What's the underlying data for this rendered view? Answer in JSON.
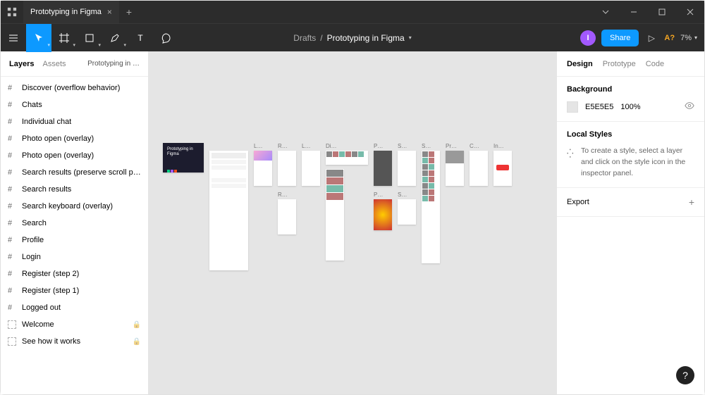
{
  "titlebar": {
    "tab_title": "Prototyping in Figma"
  },
  "toolbar": {
    "breadcrumb_folder": "Drafts",
    "breadcrumb_file": "Prototyping in Figma",
    "avatar_initial": "I",
    "share_label": "Share",
    "missing_fonts": "A?",
    "zoom": "7%"
  },
  "left_panel": {
    "tabs": {
      "layers": "Layers",
      "assets": "Assets"
    },
    "page_selector": "Prototyping in …",
    "items": [
      {
        "type": "frame",
        "label": "Discover (overflow behavior)"
      },
      {
        "type": "frame",
        "label": "Chats"
      },
      {
        "type": "frame",
        "label": "Individual chat"
      },
      {
        "type": "frame",
        "label": "Photo open (overlay)"
      },
      {
        "type": "frame",
        "label": "Photo open (overlay)"
      },
      {
        "type": "frame",
        "label": "Search results (preserve scroll po…"
      },
      {
        "type": "frame",
        "label": "Search results"
      },
      {
        "type": "frame",
        "label": "Search keyboard (overlay)"
      },
      {
        "type": "frame",
        "label": "Search"
      },
      {
        "type": "frame",
        "label": "Profile"
      },
      {
        "type": "frame",
        "label": "Login"
      },
      {
        "type": "frame",
        "label": "Register (step 2)"
      },
      {
        "type": "frame",
        "label": "Register (step 1)"
      },
      {
        "type": "frame",
        "label": "Logged out"
      },
      {
        "type": "component",
        "label": "Welcome",
        "locked": true
      },
      {
        "type": "component",
        "label": "See how it works",
        "locked": true
      }
    ]
  },
  "canvas": {
    "cover_text": "Prototyping in Figma",
    "frame_labels": [
      "L…",
      "R…",
      "L…",
      "Di…",
      "P…",
      "S…",
      "S…",
      "Pr…",
      "C…",
      "In…",
      "R…",
      "P…",
      "S…"
    ]
  },
  "right_panel": {
    "tabs": {
      "design": "Design",
      "prototype": "Prototype",
      "code": "Code"
    },
    "background": {
      "title": "Background",
      "hex": "E5E5E5",
      "opacity": "100%"
    },
    "local_styles": {
      "title": "Local Styles",
      "hint": "To create a style, select a layer and click on the style icon in the inspector panel."
    },
    "export": {
      "title": "Export"
    }
  },
  "help_label": "?"
}
